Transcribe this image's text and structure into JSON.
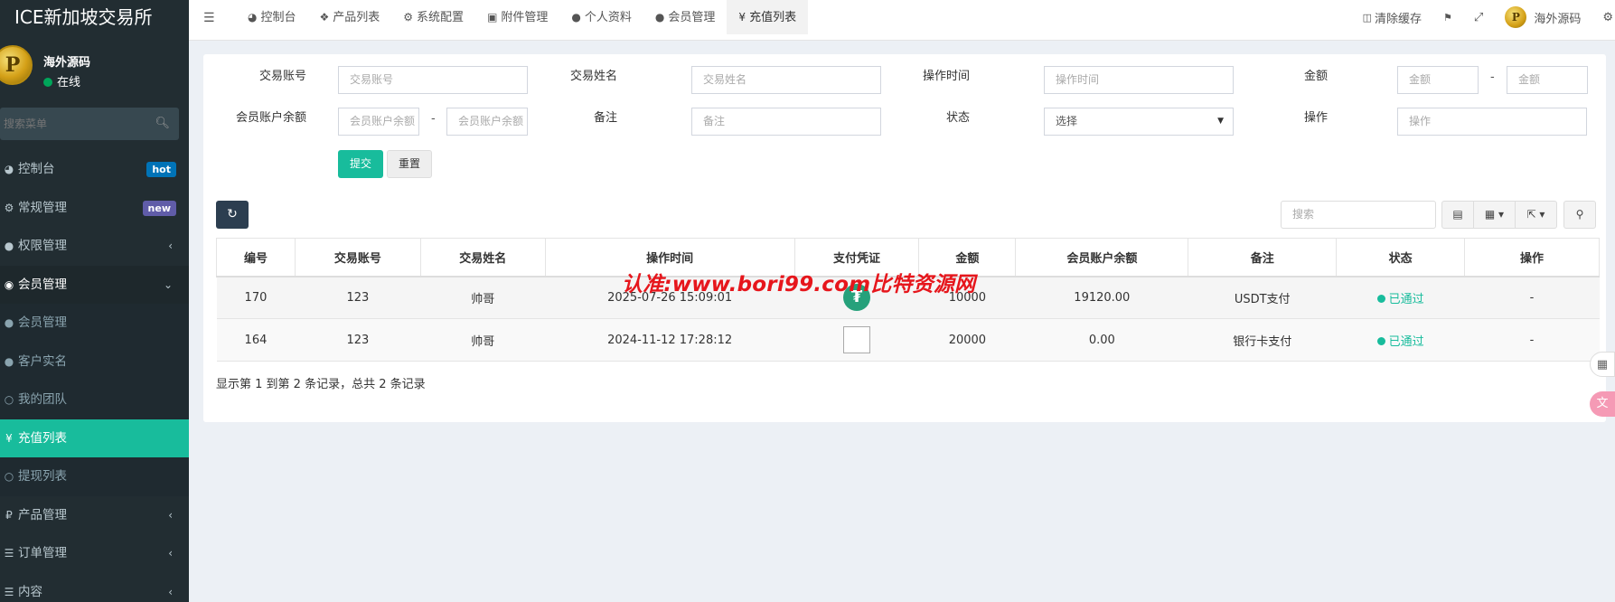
{
  "app": {
    "title": "ICE新加坡交易所"
  },
  "user": {
    "name": "海外源码",
    "status": "在线",
    "avatar_letter": "P"
  },
  "sidebar": {
    "search_placeholder": "搜索菜单",
    "items": [
      {
        "label": "控制台",
        "icon": "dashboard-icon",
        "badge": "hot"
      },
      {
        "label": "常规管理",
        "icon": "cogs-icon",
        "badge": "new"
      },
      {
        "label": "权限管理",
        "icon": "group-icon"
      },
      {
        "label": "会员管理",
        "icon": "user-circle-icon"
      },
      {
        "label": "会员管理",
        "icon": "user-icon"
      },
      {
        "label": "客户实名",
        "icon": "user-icon"
      },
      {
        "label": "我的团队",
        "icon": "circle-o-icon"
      },
      {
        "label": "充值列表",
        "icon": "yen-icon"
      },
      {
        "label": "提现列表",
        "icon": "circle-o-icon"
      },
      {
        "label": "产品管理",
        "icon": "ruble-icon"
      },
      {
        "label": "订单管理",
        "icon": "list-icon"
      },
      {
        "label": "内容",
        "icon": "list-icon"
      }
    ]
  },
  "navbar": {
    "tabs": [
      {
        "label": "控制台",
        "icon": "dashboard-icon"
      },
      {
        "label": "产品列表",
        "icon": "cubes-icon"
      },
      {
        "label": "系统配置",
        "icon": "gear-icon"
      },
      {
        "label": "附件管理",
        "icon": "image-icon"
      },
      {
        "label": "个人资料",
        "icon": "user-icon"
      },
      {
        "label": "会员管理",
        "icon": "user-icon"
      },
      {
        "label": "充值列表",
        "icon": "yen-icon"
      }
    ],
    "clear_cache": "清除缓存",
    "admin_name": "海外源码"
  },
  "form": {
    "account_label": "交易账号",
    "account_placeholder": "交易账号",
    "name_label": "交易姓名",
    "name_placeholder": "交易姓名",
    "time_label": "操作时间",
    "time_placeholder": "操作时间",
    "amount_label": "金额",
    "amount_placeholder": "金额",
    "balance_label": "会员账户余额",
    "balance_placeholder": "会员账户余额",
    "remark_label": "备注",
    "remark_placeholder": "备注",
    "status_label": "状态",
    "status_value": "选择",
    "op_label": "操作",
    "op_placeholder": "操作",
    "dash": "-",
    "submit": "提交",
    "reset": "重置"
  },
  "toolbar": {
    "search_placeholder": "搜索"
  },
  "table": {
    "headers": [
      "编号",
      "交易账号",
      "交易姓名",
      "操作时间",
      "支付凭证",
      "金额",
      "会员账户余额",
      "备注",
      "状态",
      "操作"
    ],
    "rows": [
      {
        "id": "170",
        "account": "123",
        "name": "帅哥",
        "time": "2025-07-26 15:09:01",
        "voucher": "tether-icon",
        "amount": "10000",
        "balance": "19120.00",
        "remark": "USDT支付",
        "status": "已通过",
        "op": "-"
      },
      {
        "id": "164",
        "account": "123",
        "name": "帅哥",
        "time": "2024-11-12 17:28:12",
        "voucher": "broken-image",
        "amount": "20000",
        "balance": "0.00",
        "remark": "银行卡支付",
        "status": "已通过",
        "op": "-"
      }
    ],
    "footer": "显示第 1 到第 2 条记录，总共 2 条记录"
  },
  "watermark": "认准:www.bori99.com比特资源网",
  "colors": {
    "sidebar_bg": "#222d32",
    "accent": "#18bc9c",
    "primary_dark": "#2c3e50"
  }
}
